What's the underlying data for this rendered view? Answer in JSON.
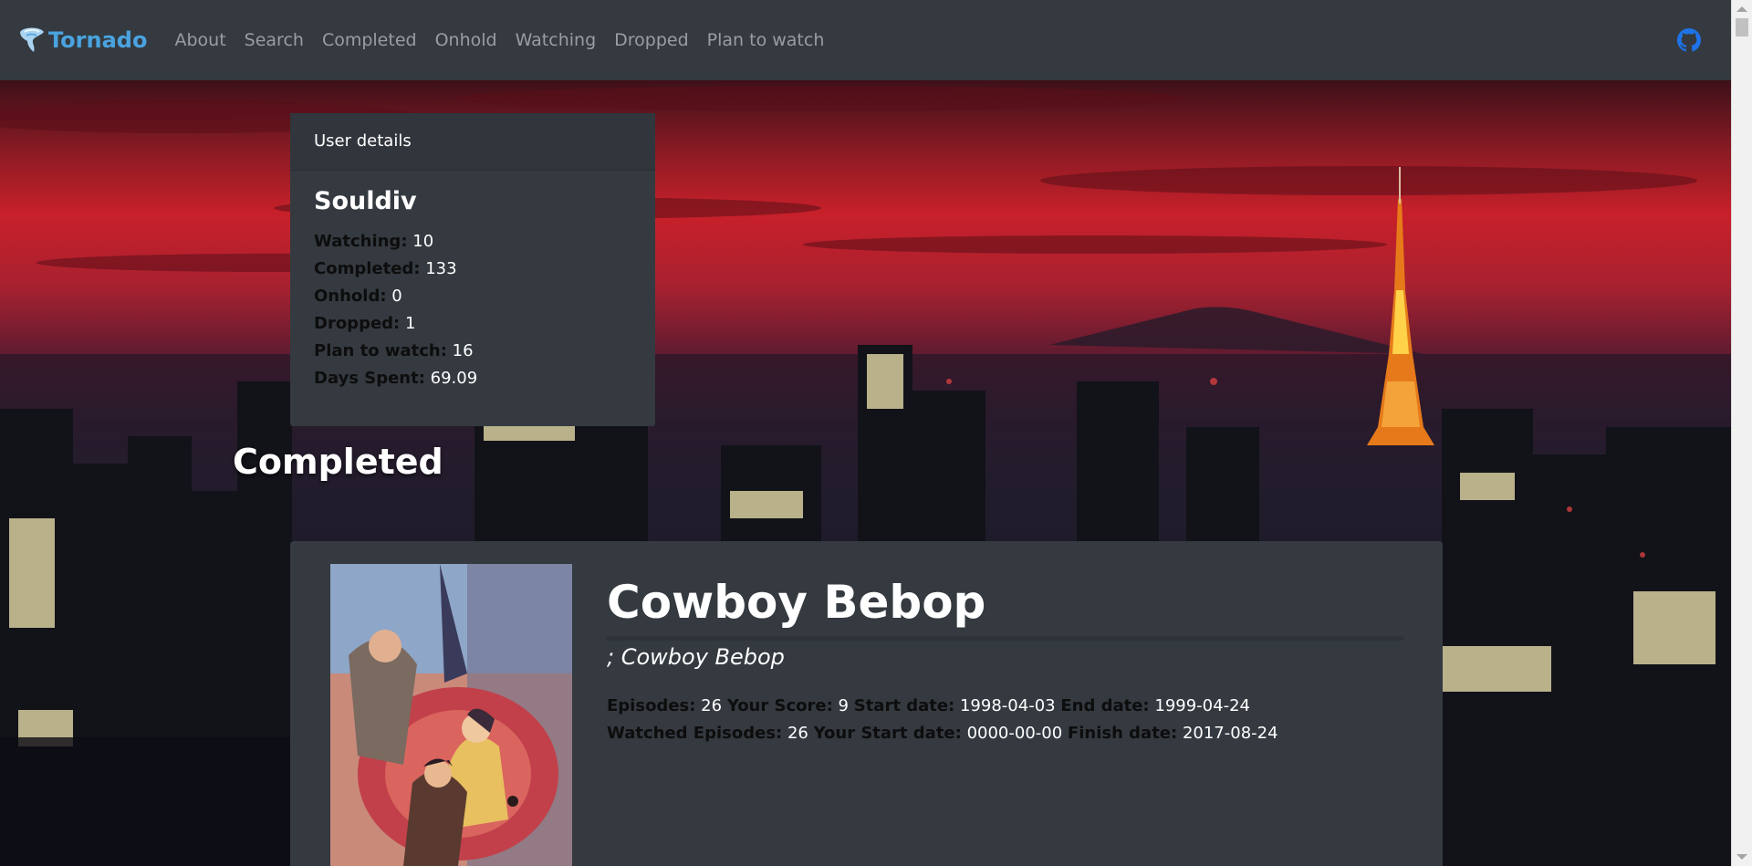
{
  "navbar": {
    "brand": "Tornado",
    "links": [
      "About",
      "Search",
      "Completed",
      "Onhold",
      "Watching",
      "Dropped",
      "Plan to watch"
    ]
  },
  "user_card": {
    "header": "User details",
    "username": "Souldiv",
    "stats": [
      {
        "label": "Watching:",
        "value": "10"
      },
      {
        "label": "Completed:",
        "value": "133"
      },
      {
        "label": "Onhold:",
        "value": "0"
      },
      {
        "label": "Dropped:",
        "value": "1"
      },
      {
        "label": "Plan to watch:",
        "value": "16"
      },
      {
        "label": "Days Spent:",
        "value": "69.09"
      }
    ]
  },
  "section_title": "Completed",
  "anime": {
    "title": "Cowboy Bebop",
    "alt_title": "; Cowboy Bebop",
    "episodes_label": "Episodes:",
    "episodes": "26",
    "score_label": "Your Score:",
    "score": "9",
    "start_label": "Start date:",
    "start": "1998-04-03",
    "end_label": "End date:",
    "end": "1999-04-24",
    "watched_label": "Watched Episodes:",
    "watched": "26",
    "your_start_label": "Your Start date:",
    "your_start": "0000-00-00",
    "finish_label": "Finish date:",
    "finish": "2017-08-24"
  },
  "colors": {
    "navbar": "#343a40",
    "card": "#343a40",
    "brand": "#4aa3df",
    "github": "#1e73e8"
  },
  "icons": {
    "brand": "tornado-logo-icon",
    "github": "github-icon"
  }
}
